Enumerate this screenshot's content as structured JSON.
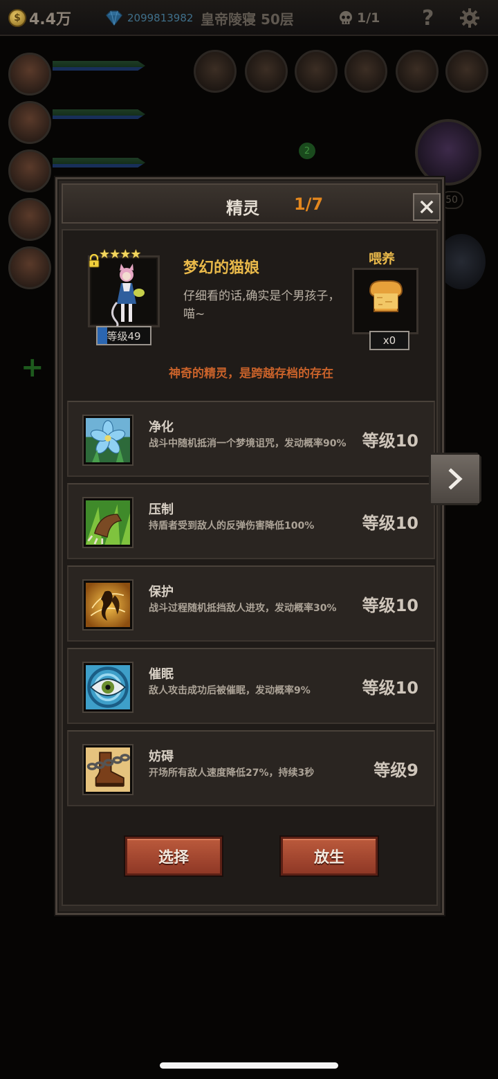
{
  "hud": {
    "gold": "4.4万",
    "gold_icon_letter": "$",
    "gems": "2099813982",
    "stage": "皇帝陵寝 50层",
    "skull_count": "1/1",
    "help": "?"
  },
  "background": {
    "badge_count": "2",
    "boss_level": "50",
    "plus": "+"
  },
  "dialog": {
    "title": "精灵",
    "count": "1/7",
    "spirit": {
      "stars": "★★★★",
      "level": "等级49",
      "name": "梦幻的猫娘",
      "description": "仔细看的话,确实是个男孩子，喵~",
      "feed_label": "喂养",
      "feed_count": "x0",
      "tagline": "神奇的精灵，是跨越存档的存在"
    },
    "skills": [
      {
        "name": "净化",
        "desc": "战斗中随机抵消一个梦境诅咒，发动概率90%",
        "level": "等级10",
        "icon": "blue-flower-icon"
      },
      {
        "name": "压制",
        "desc": "持盾者受到敌人的反弹伤害降低100%",
        "level": "等级10",
        "icon": "claw-icon"
      },
      {
        "name": "保护",
        "desc": "战斗过程随机抵挡敌人进攻，发动概率30%",
        "level": "等级10",
        "icon": "spirit-guard-icon"
      },
      {
        "name": "催眠",
        "desc": "敌人攻击成功后被催眠，发动概率9%",
        "level": "等级10",
        "icon": "eye-icon"
      },
      {
        "name": "妨碍",
        "desc": "开场所有敌人速度降低27%，持续3秒",
        "level": "等级9",
        "icon": "chained-boot-icon"
      }
    ],
    "buttons": {
      "select": "选择",
      "release": "放生"
    }
  },
  "colors": {
    "accent_gold": "#e9b94a",
    "count_orange": "#e3871e",
    "tagline_orange": "#c9622a",
    "button_red": "#a9472f"
  }
}
